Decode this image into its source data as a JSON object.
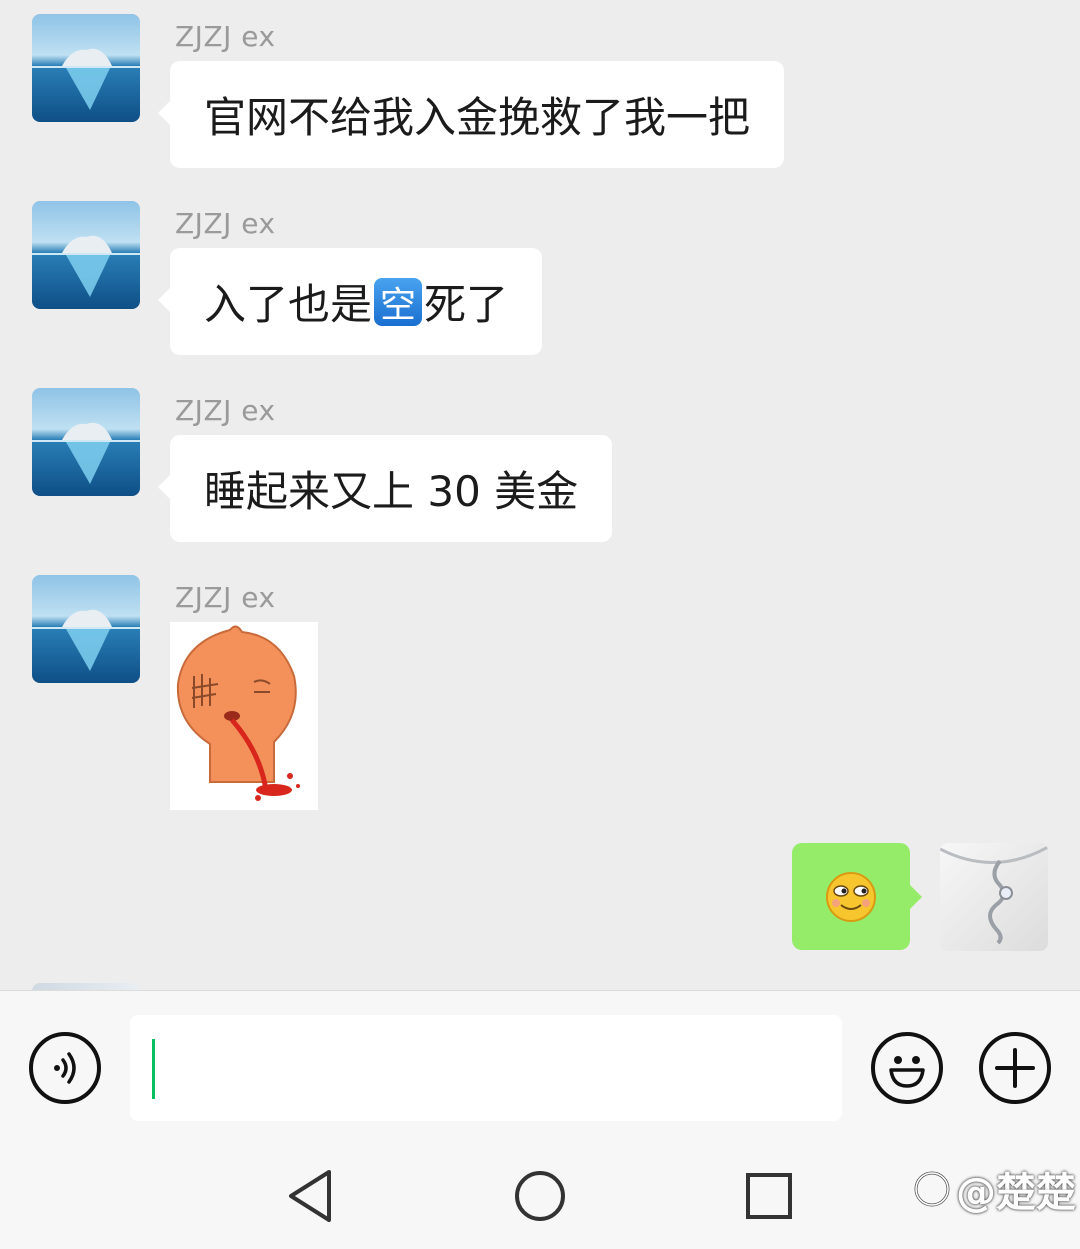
{
  "messages": [
    {
      "sender": "ZJZJ ex",
      "text": "官网不给我入金挽救了我一把"
    },
    {
      "sender": "ZJZJ ex",
      "text_before": "入了也是",
      "emoji_label": "空",
      "text_after": "死了"
    },
    {
      "sender": "ZJZJ ex",
      "text": "睡起来又上 30 美金"
    },
    {
      "sender": "ZJZJ ex",
      "sticker_icon": "spitting-blood-peach-sticker"
    }
  ],
  "my_message": {
    "emoji_icon": "smirk-emoji"
  },
  "input": {
    "value": ""
  },
  "icons": {
    "voice": "voice-icon",
    "emoji": "smile-icon",
    "plus": "plus-icon",
    "back": "back-triangle-icon",
    "home": "home-circle-icon",
    "recent": "recent-square-icon"
  },
  "watermark": {
    "text": "@楚楚"
  },
  "colors": {
    "background": "#ededed",
    "bubble_received": "#ffffff",
    "bubble_sent": "#95ec69",
    "cursor": "#07c160",
    "sender_name": "#9a9a9a"
  }
}
